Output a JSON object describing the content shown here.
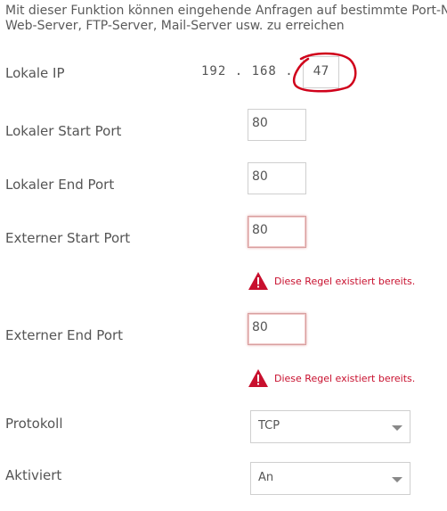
{
  "intro": {
    "line1": "Mit dieser Funktion können eingehende Anfragen auf bestimmte Port-N",
    "line2": "Web-Server, FTP-Server, Mail-Server usw. zu erreichen"
  },
  "lokale_ip": {
    "label": "Lokale IP",
    "prefix": "192 . 168 . 0",
    "last_octet": "47"
  },
  "lokaler_start_port": {
    "label": "Lokaler Start Port",
    "value": "80"
  },
  "lokaler_end_port": {
    "label": "Lokaler End Port",
    "value": "80"
  },
  "externer_start_port": {
    "label": "Externer Start Port",
    "value": "80",
    "error": "Diese Regel existiert bereits."
  },
  "externer_end_port": {
    "label": "Externer End Port",
    "value": "80",
    "error": "Diese Regel existiert bereits."
  },
  "protokoll": {
    "label": "Protokoll",
    "selected": "TCP"
  },
  "aktiviert": {
    "label": "Aktiviert",
    "selected": "An"
  },
  "colors": {
    "error": "#c8102e",
    "annotation": "#d0021b"
  },
  "icons": {
    "error": "warning-triangle-icon",
    "dropdown": "chevron-down-icon"
  }
}
